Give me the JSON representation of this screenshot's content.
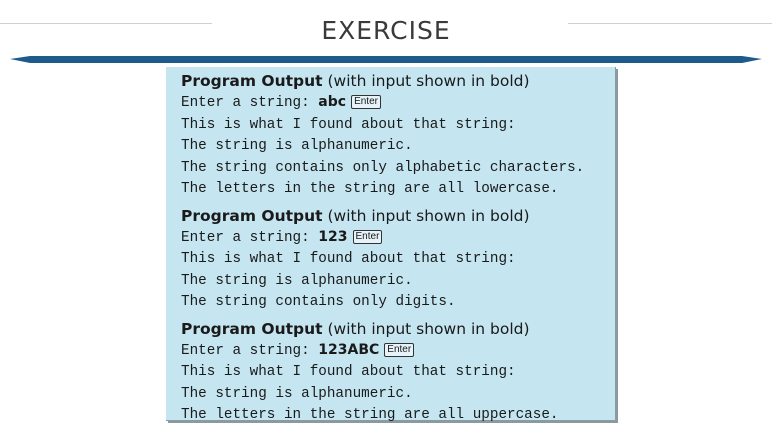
{
  "slide": {
    "title": "EXERCISE",
    "colors": {
      "bar": "#1f5a8c",
      "panel": "#c5e6f1"
    }
  },
  "sections": [
    {
      "head_bold": "Program Output",
      "head_rest": " (with input shown in bold)",
      "prompt": "Enter a string: ",
      "input": "abc",
      "key": "Enter",
      "lines": [
        "This is what I found about that string:",
        "The string is alphanumeric.",
        "The string contains only alphabetic characters.",
        "The letters in the string are all lowercase."
      ]
    },
    {
      "head_bold": "Program Output",
      "head_rest": " (with input shown in bold)",
      "prompt": "Enter a string: ",
      "input": "123",
      "key": "Enter",
      "lines": [
        "This is what I found about that string:",
        "The string is alphanumeric.",
        "The string contains only digits."
      ]
    },
    {
      "head_bold": "Program Output",
      "head_rest": " (with input shown in bold)",
      "prompt": "Enter a string: ",
      "input": "123ABC",
      "key": "Enter",
      "lines": [
        "This is what I found about that string:",
        "The string is alphanumeric.",
        "The letters in the string are all uppercase."
      ]
    }
  ]
}
